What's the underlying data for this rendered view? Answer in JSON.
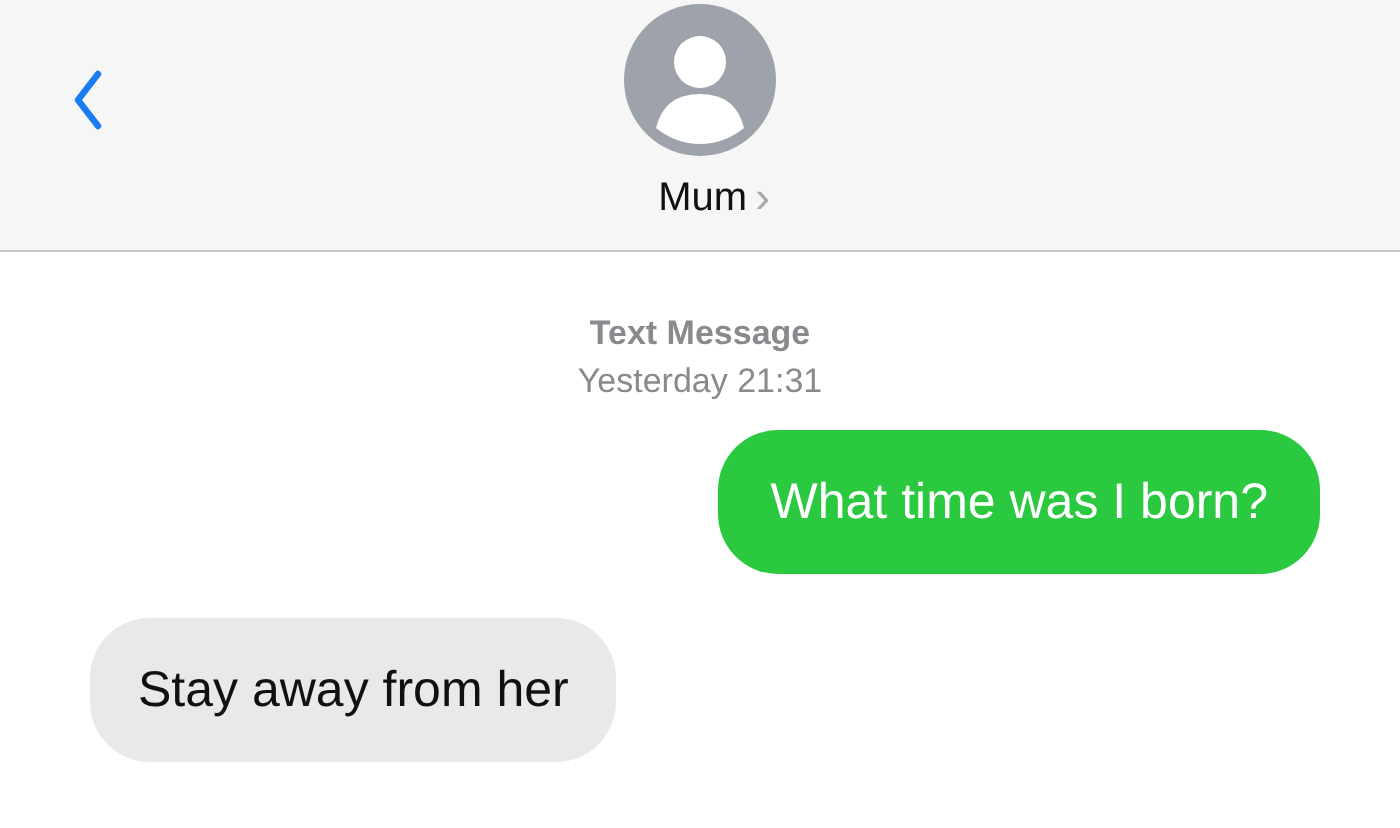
{
  "header": {
    "contact_name": "Mum",
    "chevron": "›"
  },
  "timestamp": {
    "service": "Text Message",
    "time": "Yesterday 21:31"
  },
  "messages": [
    {
      "kind": "sent",
      "text": "What time was I born?"
    },
    {
      "kind": "received",
      "text": "Stay away from her"
    }
  ]
}
